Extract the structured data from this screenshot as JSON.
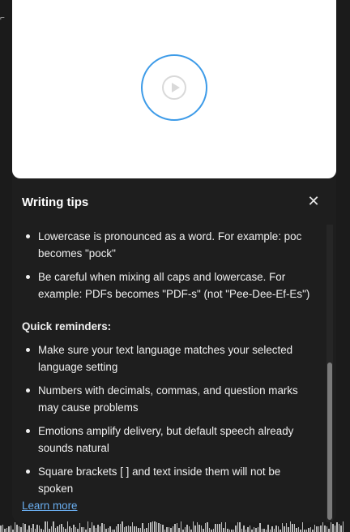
{
  "modal": {
    "title": "Writing tips",
    "close_icon": "close-icon",
    "video": {
      "play_icon": "play-circle-icon",
      "accent": "#3d9be8"
    },
    "tips": [
      "Lowercase is pronounced as a word. For example: poc becomes \"pock\"",
      "Be careful when mixing all caps and lowercase. For example: PDFs becomes \"PDF-s\" (not \"Pee-Dee-Ef-Es\")"
    ],
    "reminders_title": "Quick reminders:",
    "reminders": [
      "Make sure your text language matches your selected language setting",
      "Numbers with decimals, commas, and question marks may cause problems",
      "Emotions amplify delivery, but default speech already sounds natural",
      "Square brackets [ ] and text inside them will not be spoken"
    ],
    "learn_more": "Learn more",
    "link_color": "#6aaef0"
  }
}
